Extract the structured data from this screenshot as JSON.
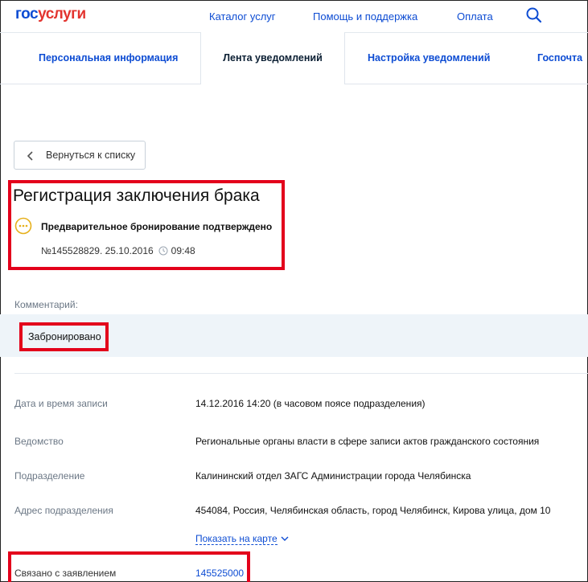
{
  "header": {
    "logo_part1": "гос",
    "logo_part2": "услуги",
    "nav": [
      "Каталог услуг",
      "Помощь и поддержка",
      "Оплата"
    ]
  },
  "tabs": [
    {
      "label": "Персональная информация",
      "active": false
    },
    {
      "label": "Лента уведомлений",
      "active": true
    },
    {
      "label": "Настройка уведомлений",
      "active": false
    },
    {
      "label": "Госпочта",
      "active": false
    }
  ],
  "back_button": {
    "label": "Вернуться к списку"
  },
  "application": {
    "title": "Регистрация заключения брака",
    "status": "Предварительное бронирование подтверждено",
    "number": "№145528829",
    "date": "25.10.2016",
    "time": "09:48"
  },
  "comment": {
    "label": "Комментарий:",
    "text": "Забронировано"
  },
  "details": [
    {
      "label": "Дата и время записи",
      "value": "14.12.2016 14:20 (в часовом поясе подразделения)"
    },
    {
      "label": "Ведомство",
      "value": "Региональные органы власти в сфере записи актов гражданского состояния"
    },
    {
      "label": "Подразделение",
      "value": "Калининский отдел ЗАГС Администрации города Челябинска"
    },
    {
      "label": "Адрес подразделения",
      "value": "454084, Россия, Челябинская область, город Челябинск, Кирова улица, дом 10"
    }
  ],
  "map_link": "Показать на карте",
  "linked": {
    "label": "Связано с заявлением",
    "value": "145525000"
  },
  "colors": {
    "brand_blue": "#0d4cd3",
    "brand_red": "#e3342f",
    "highlight_red": "#e3001b",
    "status_yellow": "#e6b01b"
  }
}
